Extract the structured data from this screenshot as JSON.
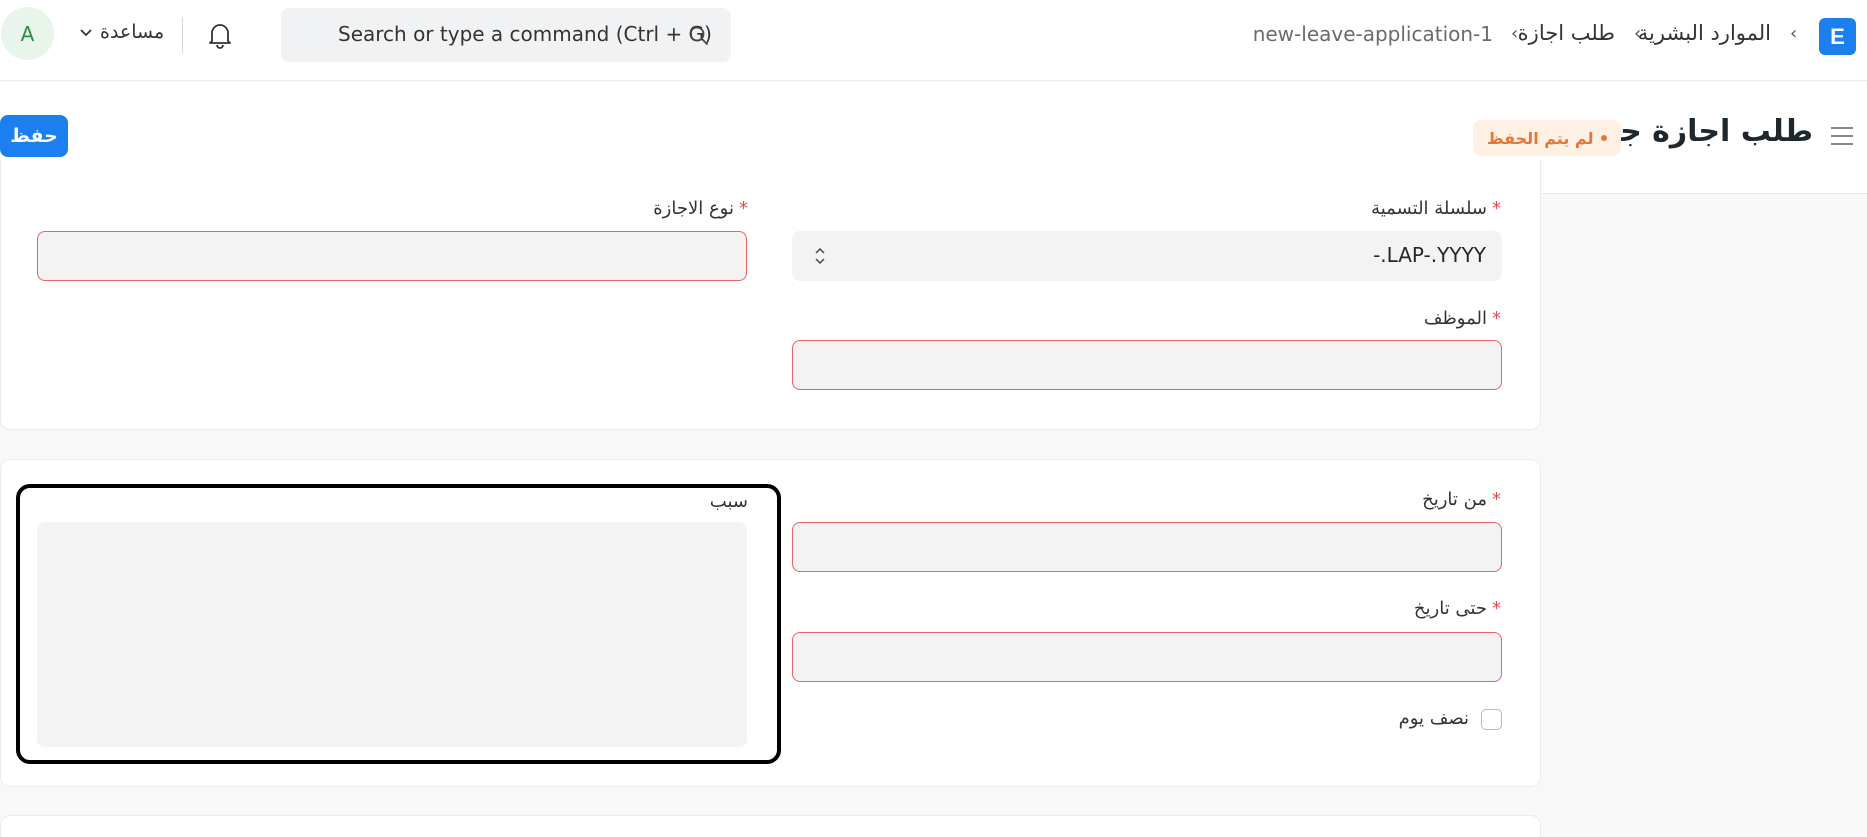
{
  "navbar": {
    "logo_letter": "E",
    "breadcrumbs": [
      "الموارد البشرية",
      "طلب اجازة",
      "new-leave-application-1"
    ],
    "search_placeholder": "Search or type a command (Ctrl + G)",
    "help_label": "مساعدة",
    "avatar_initial": "A"
  },
  "page": {
    "title": "طلب اجازة جديد",
    "status": "لم يتم الحفظ",
    "save_label": "حفظ"
  },
  "form": {
    "naming_series": {
      "label": "سلسلة التسمية",
      "value": "-.LAP-.YYYY"
    },
    "employee": {
      "label": "الموظف",
      "value": ""
    },
    "leave_type": {
      "label": "نوع الاجازة",
      "value": ""
    },
    "from_date": {
      "label": "من تاريخ",
      "value": ""
    },
    "to_date": {
      "label": "حتى تاريخ",
      "value": ""
    },
    "half_day": {
      "label": "نصف يوم",
      "checked": false
    },
    "reason": {
      "label": "سبب",
      "value": ""
    },
    "required_marker": "*"
  },
  "colors": {
    "accent": "#1b7ff0",
    "required": "#e24c4c",
    "status": "#e5773a"
  }
}
